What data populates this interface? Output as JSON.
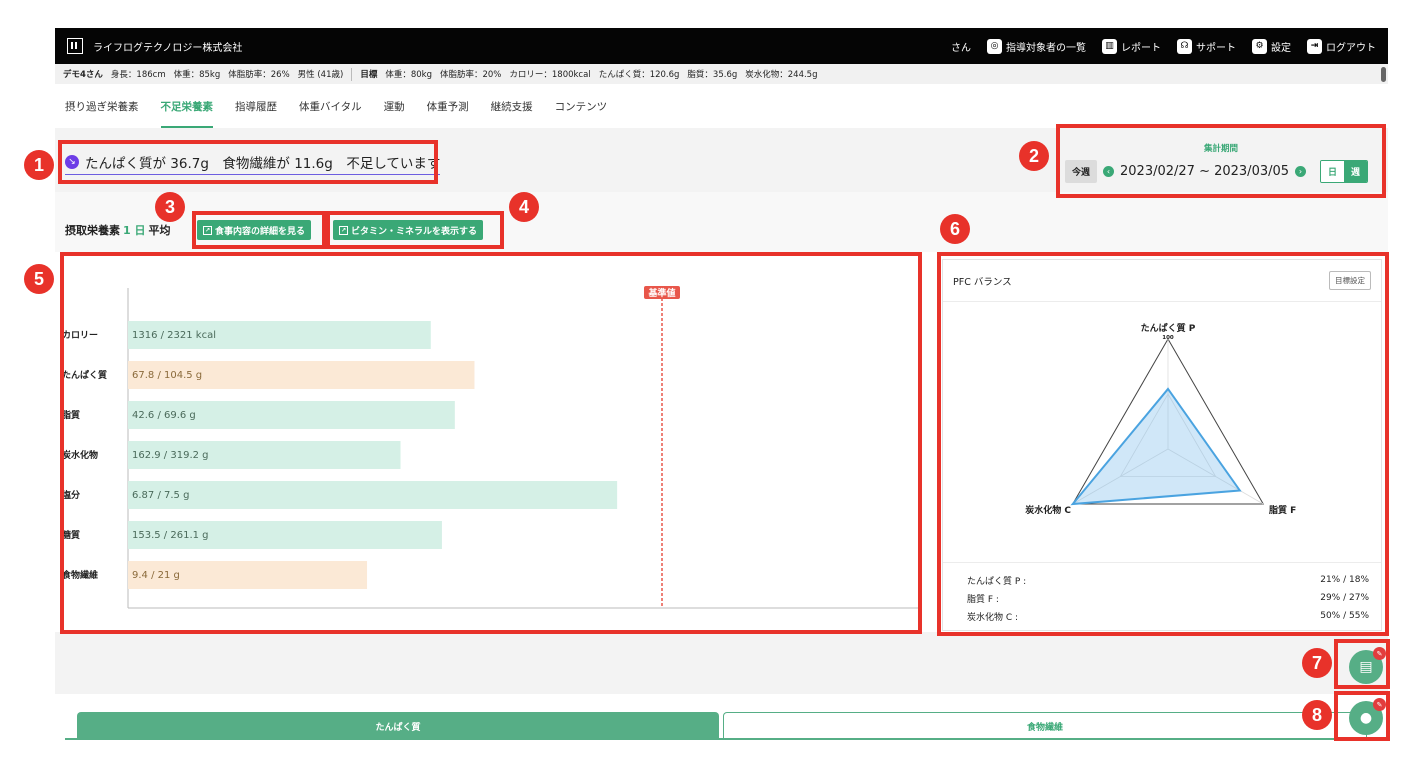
{
  "header": {
    "company": "ライフログテクノロジー株式会社",
    "user_suffix": "さん",
    "nav": [
      {
        "label": "指導対象者の一覧",
        "icon": "person-circle-icon"
      },
      {
        "label": "レポート",
        "icon": "chart-icon"
      },
      {
        "label": "サポート",
        "icon": "headset-icon"
      },
      {
        "label": "設定",
        "icon": "gear-icon"
      },
      {
        "label": "ログアウト",
        "icon": "logout-icon"
      }
    ]
  },
  "info": {
    "name": "デモ4さん",
    "height": "身長：186cm",
    "weight": "体重：85kg",
    "fat": "体脂肪率：26%",
    "sex_age": "男性 (41歳)",
    "goal_label": "目標",
    "goal_weight": "体重：80kg",
    "goal_fat": "体脂肪率：20%",
    "goal_cal": "カロリー：1800kcal",
    "goal_protein": "たんぱく質：120.6g",
    "goal_lipid": "脂質：35.6g",
    "goal_carb": "炭水化物：244.5g"
  },
  "tabs": [
    "摂り過ぎ栄養素",
    "不足栄養素",
    "指導履歴",
    "体重バイタル",
    "運動",
    "体重予測",
    "継続支援",
    "コンテンツ"
  ],
  "alert": {
    "text": "たんぱく質が 36.7g　食物繊維が 11.6g　不足しています"
  },
  "period": {
    "label": "集計期間",
    "this_week": "今週",
    "range": "2023/02/27 ~ 2023/03/05",
    "day": "日",
    "week": "週"
  },
  "intake": {
    "title_pre": "摂取栄養素",
    "title_mid": "1 日",
    "title_post": "平均"
  },
  "buttons": {
    "meal_detail": "食事内容の詳細を見る",
    "vitamin": "ビタミン・ミネラルを表示する"
  },
  "chart_data": {
    "type": "bar",
    "orientation": "horizontal",
    "reference_label": "基準値",
    "categories": [
      "カロリー",
      "たんぱく質",
      "脂質",
      "炭水化物",
      "塩分",
      "糖質",
      "食物繊維"
    ],
    "labels": [
      "1316 / 2321 kcal",
      "67.8 / 104.5 g",
      "42.6 / 69.6 g",
      "162.9 / 319.2 g",
      "6.87 / 7.5 g",
      "153.5 / 261.1 g",
      "9.4 / 21 g"
    ],
    "values": [
      1316,
      67.8,
      42.6,
      162.9,
      6.87,
      153.5,
      9.4
    ],
    "targets": [
      2321,
      104.5,
      69.6,
      319.2,
      7.5,
      261.1,
      21
    ],
    "deficient": [
      false,
      true,
      false,
      false,
      false,
      false,
      true
    ],
    "colors": {
      "normal": "#d5f0e6",
      "deficient": "#fbe9d6",
      "reference": "#e8564a"
    }
  },
  "pfc": {
    "title": "PFC バランス",
    "goal_button": "目標設定",
    "axis_top": "たんぱく質 P",
    "axis_top_max": "100",
    "axis_left": "炭水化物 C",
    "axis_right": "脂質 F",
    "values": {
      "P": 21,
      "F": 29,
      "C": 50
    },
    "legend": [
      {
        "label": "たんぱく質 P :",
        "value": "21% / 18%"
      },
      {
        "label": "脂質 F :",
        "value": "29% / 27%"
      },
      {
        "label": "炭水化物 C :",
        "value": "50% / 55%"
      }
    ]
  },
  "bottom_tabs": [
    "たんぱく質",
    "食物繊維"
  ],
  "markers": [
    "1",
    "2",
    "3",
    "4",
    "5",
    "6",
    "7",
    "8"
  ]
}
